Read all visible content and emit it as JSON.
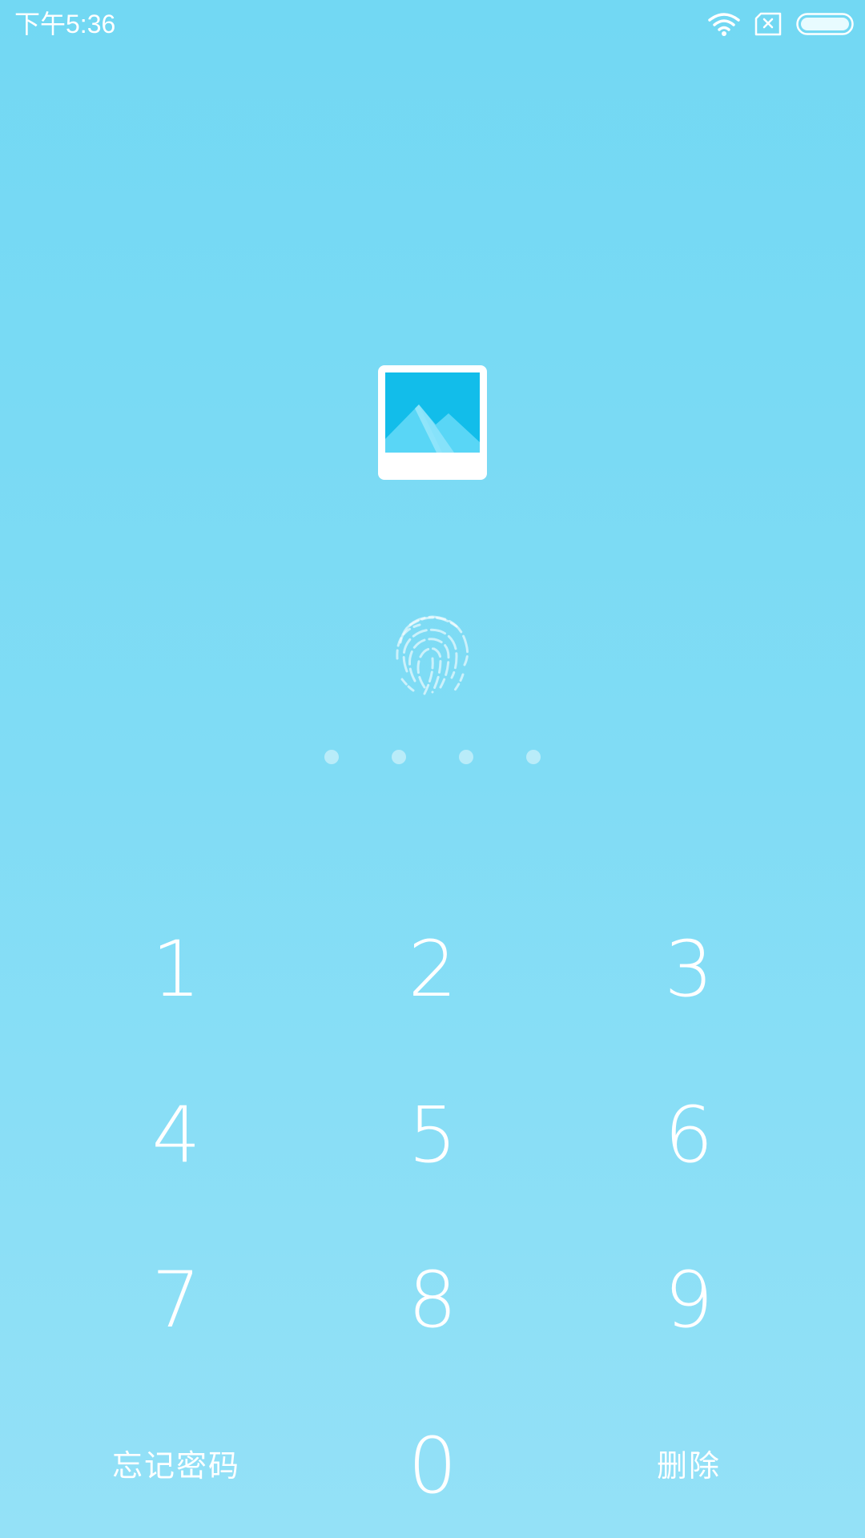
{
  "status_bar": {
    "time": "下午5:36",
    "icons": [
      "wifi-icon",
      "sim-card-missing-icon",
      "battery-icon"
    ]
  },
  "app_icon": "gallery-icon",
  "fingerprint_icon": "fingerprint-icon",
  "pin": {
    "length": 4,
    "entered": 0
  },
  "keypad": {
    "keys": [
      {
        "label": "1"
      },
      {
        "label": "2"
      },
      {
        "label": "3"
      },
      {
        "label": "4"
      },
      {
        "label": "5"
      },
      {
        "label": "6"
      },
      {
        "label": "7"
      },
      {
        "label": "8"
      },
      {
        "label": "9"
      },
      {
        "label": "忘记密码"
      },
      {
        "label": "0"
      },
      {
        "label": "删除"
      }
    ]
  },
  "colors": {
    "background_top": "#72d8f3",
    "background_bottom": "#94e1f7",
    "foreground": "#ffffff",
    "gallery_sky": "#12bdea"
  }
}
